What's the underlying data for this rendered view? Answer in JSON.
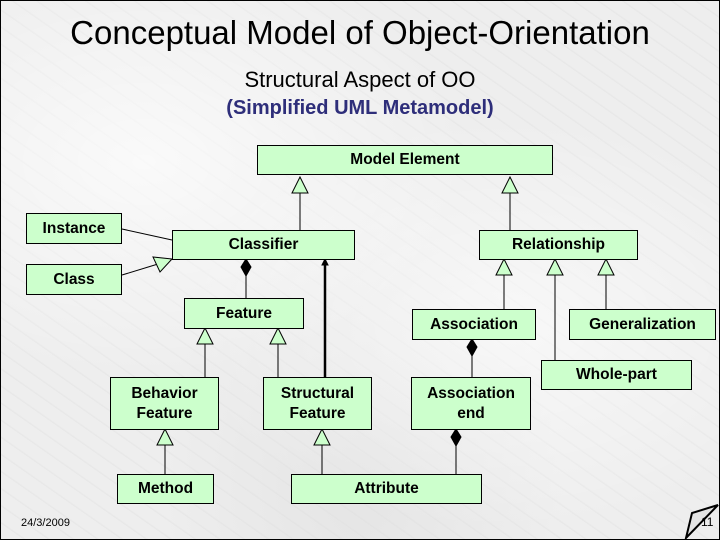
{
  "slide": {
    "title": "Conceptual Model of Object-Orientation",
    "subtitle": "Structural Aspect of OO",
    "subtitle2": "(Simplified UML Metamodel)",
    "date": "24/3/2009",
    "page_number": "11"
  },
  "colors": {
    "box_fill": "#ccffcc",
    "subtitle2": "#2e2e7a",
    "line": "#000000"
  },
  "diagram": {
    "nodes": {
      "model_element": "Model Element",
      "instance": "Instance",
      "classifier": "Classifier",
      "relationship": "Relationship",
      "class": "Class",
      "feature": "Feature",
      "association": "Association",
      "generalization": "Generalization",
      "whole_part": "Whole-part",
      "behavior_feature_1": "Behavior",
      "behavior_feature_2": "Feature",
      "structural_feature_1": "Structural",
      "structural_feature_2": "Feature",
      "association_end_1": "Association",
      "association_end_2": "end",
      "method": "Method",
      "attribute": "Attribute"
    },
    "relations": [
      {
        "from": "Classifier",
        "to": "Model Element",
        "type": "generalization"
      },
      {
        "from": "Relationship",
        "to": "Model Element",
        "type": "generalization"
      },
      {
        "from": "Instance",
        "to": "Classifier",
        "type": "association"
      },
      {
        "from": "Class",
        "to": "Classifier",
        "type": "generalization"
      },
      {
        "from": "Feature",
        "to": "Classifier",
        "type": "composition"
      },
      {
        "from": "Structural Feature",
        "to": "Classifier",
        "type": "directed-association"
      },
      {
        "from": "Association",
        "to": "Relationship",
        "type": "generalization"
      },
      {
        "from": "Whole-part",
        "to": "Relationship",
        "type": "generalization"
      },
      {
        "from": "Generalization",
        "to": "Relationship",
        "type": "generalization"
      },
      {
        "from": "Behavior Feature",
        "to": "Feature",
        "type": "generalization"
      },
      {
        "from": "Structural Feature",
        "to": "Feature",
        "type": "generalization"
      },
      {
        "from": "Association end",
        "to": "Association",
        "type": "composition"
      },
      {
        "from": "Method",
        "to": "Behavior Feature",
        "type": "generalization"
      },
      {
        "from": "Attribute",
        "to": "Structural Feature",
        "type": "generalization"
      },
      {
        "from": "Attribute",
        "to": "Association end",
        "type": "composition"
      }
    ]
  }
}
